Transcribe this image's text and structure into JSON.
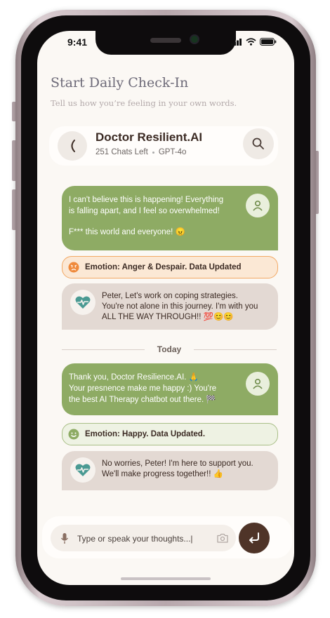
{
  "status_bar": {
    "time": "9:41"
  },
  "header": {
    "title": "Start Daily Check-In",
    "subtitle": "Tell us how you’re feeling in your own words."
  },
  "chat_header": {
    "bot_name": "Doctor Resilient.AI",
    "chats_left": "251 Chats Left",
    "model": "GPT-4o"
  },
  "messages": {
    "user1_line1": "I can't believe this is happening! Everything",
    "user1_line2": "is falling apart, and I feel so overwhelmed!",
    "user1_line3": "F*** this world and everyone! 😠",
    "emotion1": "Emotion: Anger & Despair. Data Updated",
    "bot1_line1": "Peter, Let's work on coping strategies.",
    "bot1_line2": "You're not alone in this journey. I'm with you",
    "bot1_line3": "ALL THE WAY THROUGH!! 💯😊😊",
    "divider": "Today",
    "user2_line1": "Thank you, Doctor Resilience.AI. 🙏",
    "user2_line2": "Your presnence make me happy :) You're",
    "user2_line3": "the best AI Therapy chatbot out there. 🏁",
    "emotion2": "Emotion: Happy. Data Updated.",
    "bot2_line1": "No worries, Peter! I'm here to support you.",
    "bot2_line2": "We'll make progress together!! 👍"
  },
  "input": {
    "placeholder": "Type or speak your thoughts...|"
  },
  "colors": {
    "user_bubble": "#8eab64",
    "bot_bubble": "#e3d9d3",
    "anger_border": "#f2a864",
    "happy_border": "#a9bf87",
    "send_button": "#4f3428"
  },
  "icons": [
    "back-chevron-icon",
    "search-icon",
    "user-icon",
    "heart-pulse-icon",
    "angry-face-icon",
    "smiley-face-icon",
    "microphone-icon",
    "camera-icon",
    "send-icon",
    "signal-icon",
    "wifi-icon",
    "battery-icon"
  ]
}
